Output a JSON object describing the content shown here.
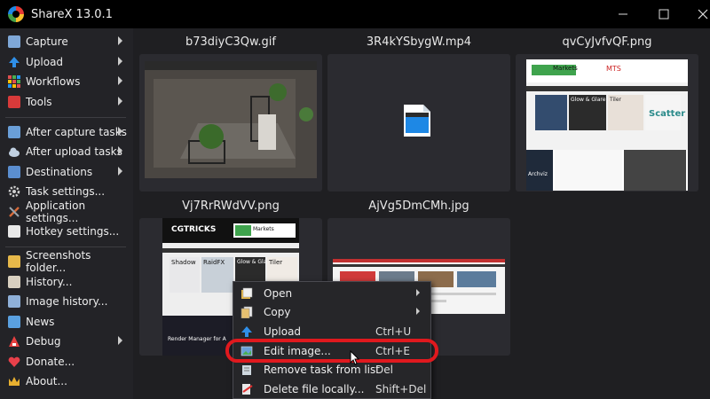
{
  "window": {
    "title": "ShareX 13.0.1"
  },
  "sidebar": {
    "items": [
      {
        "label": "Capture",
        "icon": "camera-icon",
        "color": "#7fa8d8",
        "submenu": true
      },
      {
        "label": "Upload",
        "icon": "upload-arrow-icon",
        "color": "#2f8fe8",
        "submenu": true
      },
      {
        "label": "Workflows",
        "icon": "workflows-grid-icon",
        "color": "#e05050",
        "submenu": true
      },
      {
        "label": "Tools",
        "icon": "toolbox-icon",
        "color": "#d83a3a",
        "submenu": true
      },
      {
        "label": "After capture tasks",
        "icon": "after-capture-icon",
        "color": "#6a9fd8",
        "submenu": true
      },
      {
        "label": "After upload tasks",
        "icon": "cloud-icon",
        "color": "#bfcfe0",
        "submenu": true
      },
      {
        "label": "Destinations",
        "icon": "destinations-icon",
        "color": "#5b8ed0",
        "submenu": true
      },
      {
        "label": "Task settings...",
        "icon": "gear-icon",
        "color": "#cfcfcf",
        "submenu": false
      },
      {
        "label": "Application settings...",
        "icon": "wrench-icon",
        "color": "#d66a3a",
        "submenu": false
      },
      {
        "label": "Hotkey settings...",
        "icon": "keyboard-icon",
        "color": "#e8e8e8",
        "submenu": false
      },
      {
        "label": "Screenshots folder...",
        "icon": "folder-icon",
        "color": "#e6b84a",
        "submenu": false
      },
      {
        "label": "History...",
        "icon": "history-icon",
        "color": "#d9d0c0",
        "submenu": false
      },
      {
        "label": "Image history...",
        "icon": "image-history-icon",
        "color": "#8fb0d8",
        "submenu": false
      },
      {
        "label": "News",
        "icon": "news-icon",
        "color": "#5aa0e0",
        "submenu": false
      },
      {
        "label": "Debug",
        "icon": "debug-icon",
        "color": "#e84040",
        "submenu": true
      },
      {
        "label": "Donate...",
        "icon": "heart-icon",
        "color": "#e8404a",
        "submenu": false
      },
      {
        "label": "About...",
        "icon": "crown-icon",
        "color": "#e8b030",
        "submenu": false
      }
    ]
  },
  "thumbnails": [
    {
      "name": "b73diyC3Qw.gif",
      "kind": "render-scene"
    },
    {
      "name": "3R4kYSbygW.mp4",
      "kind": "video-file"
    },
    {
      "name": "qvCyJvfvQF.png",
      "kind": "website"
    },
    {
      "name": "Vj7RrRWdVV.png",
      "kind": "website-cgtricks"
    },
    {
      "name": "AjVg5DmCMh.jpg",
      "kind": "website-wide"
    }
  ],
  "context_menu": {
    "items": [
      {
        "label": "Open",
        "shortcut": "",
        "icon": "open-file-icon",
        "submenu": true
      },
      {
        "label": "Copy",
        "shortcut": "",
        "icon": "copy-icon",
        "submenu": true
      },
      {
        "label": "Upload",
        "shortcut": "Ctrl+U",
        "icon": "upload-arrow-icon",
        "submenu": false
      },
      {
        "label": "Edit image...",
        "shortcut": "Ctrl+E",
        "icon": "edit-image-icon",
        "submenu": false
      },
      {
        "label": "Remove task from list",
        "shortcut": "Del",
        "icon": "remove-icon",
        "submenu": false
      },
      {
        "label": "Delete file locally...",
        "shortcut": "Shift+Del",
        "icon": "delete-file-icon",
        "submenu": false
      }
    ]
  },
  "preview_text": {
    "cgtricks_logo": "CGTRICKS",
    "site_tile_1": "Shadow",
    "site_tile_2": "RaidFX",
    "site_tile_3": "Glow & Glare",
    "site_tile_4": "Tiler",
    "render_banner": "Render Manager for A",
    "qv_tile_1": "Glow & Glare",
    "qv_tile_2": "Tiler",
    "qv_scatter": "Scatter",
    "qv_archviz": "Archviz",
    "mts": "MTS",
    "markets": "Markets",
    "markets2": "Markets"
  },
  "colors": {
    "highlight_ring": "#e0191e",
    "title_bar": "#000000",
    "sidebar_bg": "#232327",
    "tile_bg": "#2b2b30",
    "accent_green": "#3fa34d"
  }
}
